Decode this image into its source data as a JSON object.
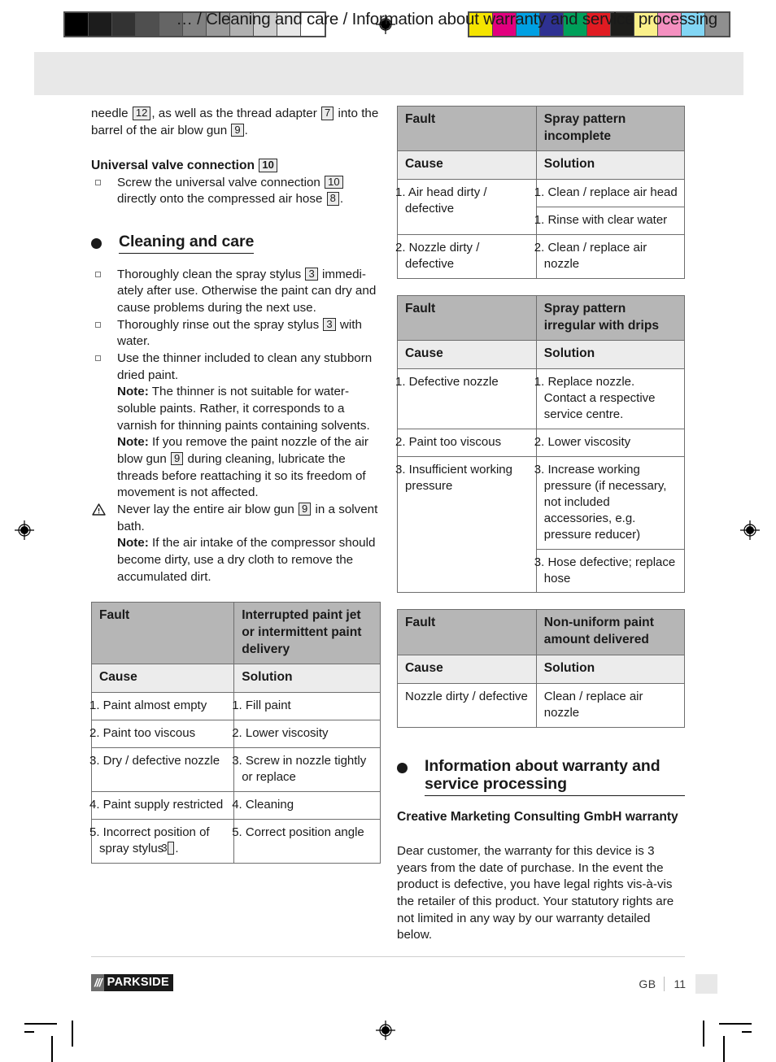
{
  "document": {
    "header_title": "… / Cleaning and care / Information about warranty and service processing",
    "footer": {
      "logo_slashes": "///",
      "logo_word": "PARKSIDE",
      "language": "GB",
      "page_number": "11"
    }
  },
  "calibration": {
    "gray_wedge": [
      "#000000",
      "#1c1c1c",
      "#333333",
      "#4f4f4f",
      "#656565",
      "#808080",
      "#999999",
      "#b0b0b0",
      "#cccccc",
      "#e8e8e8",
      "#ffffff"
    ],
    "color_patches": [
      "#f5e400",
      "#e2007f",
      "#00a0e3",
      "#2e3192",
      "#00a05a",
      "#e11b22",
      "#1d1d1b",
      "#faf08a",
      "#f490c0",
      "#82d6f5",
      "#8f8f8f"
    ]
  },
  "left_column": {
    "continued_paragraph": {
      "pre": "needle",
      "chip1": "12",
      "mid": ", as well as the thread adapter",
      "chip2": "7",
      "line2_pre": "into the barrel of the air blow gun",
      "chip3": "9",
      "line2_post": "."
    },
    "valve_subheading": {
      "text": "Universal valve connection",
      "chip": "10"
    },
    "valve_item": {
      "pre": "Screw the universal valve connection",
      "chip1": "10",
      "mid": "directly onto the compressed air hose",
      "chip2": "8",
      "post": "."
    },
    "cleaning_heading": "Cleaning and care",
    "cleaning_items": [
      {
        "marker": "square",
        "pre": "Thoroughly clean the spray stylus",
        "chip": "3",
        "post": "immedi-ately after use. Otherwise the paint can dry and cause problems during the next use."
      },
      {
        "marker": "square",
        "pre": "Thoroughly rinse out the spray stylus",
        "chip": "3",
        "post": "with water."
      },
      {
        "marker": "square",
        "pre": "Use the thinner included to clean any stubborn dried paint.",
        "note1_label": "Note:",
        "note1_text": "The thinner is not suitable for water-soluble paints. Rather, it corresponds to a varnish for thinning paints containing solvents.",
        "note2_label": "Note:",
        "note2_pre": "If you remove the paint nozzle of the air blow gun",
        "note2_chip": "9",
        "note2_post": "during cleaning, lubricate the threads before reattaching it so its freedom of movement is not affected."
      },
      {
        "marker": "warning",
        "pre": "Never lay the entire air blow gun",
        "chip": "9",
        "post": "in a solvent bath.",
        "note_label": "Note:",
        "note_text": "If the air intake of the compressor should become dirty, use a dry cloth to remove the accumulated dirt."
      }
    ],
    "table": {
      "fault_label": "Fault",
      "fault_value": "Interrupted paint jet or intermittent paint delivery",
      "cause_label": "Cause",
      "solution_label": "Solution",
      "rows": [
        {
          "cause": "1. Paint almost empty",
          "solution": "1. Fill paint"
        },
        {
          "cause": "2. Paint too viscous",
          "solution": "2. Lower viscosity"
        },
        {
          "cause": "3. Dry / defective nozzle",
          "solution": "3. Screw in nozzle tightly or replace"
        },
        {
          "cause": "4. Paint supply restricted",
          "solution": "4. Cleaning"
        },
        {
          "cause_pre": "5. Incorrect position of spray stylus",
          "cause_chip": "3",
          "cause_post": ".",
          "solution": "5. Correct position angle"
        }
      ]
    }
  },
  "right_column": {
    "table1": {
      "fault_label": "Fault",
      "fault_value": "Spray pattern incomplete",
      "cause_label": "Cause",
      "solution_label": "Solution",
      "rows": [
        {
          "cause": "1. Air head dirty / defective",
          "solution": "1. Clean / replace air head"
        },
        {
          "cause": "",
          "solution": "1. Rinse with clear water"
        },
        {
          "cause": "2. Nozzle dirty / defective",
          "solution": "2. Clean / replace air nozzle"
        }
      ]
    },
    "table2": {
      "fault_label": "Fault",
      "fault_value": "Spray pattern irregular with drips",
      "cause_label": "Cause",
      "solution_label": "Solution",
      "rows": [
        {
          "cause": "1. Defective nozzle",
          "solution": "1. Replace nozzle. Contact a respective service centre."
        },
        {
          "cause": "2. Paint too viscous",
          "solution": "2. Lower viscosity"
        },
        {
          "cause": "3. Insufficient working pressure",
          "solution": "3. Increase working pressure (if necessary, not included accessories, e.g. pressure reducer)"
        },
        {
          "cause": "",
          "solution": "3. Hose defective; replace hose"
        }
      ]
    },
    "table3": {
      "fault_label": "Fault",
      "fault_value": "Non-uniform paint amount delivered",
      "cause_label": "Cause",
      "solution_label": "Solution",
      "rows": [
        {
          "cause": "Nozzle dirty / defective",
          "solution": "Clean / replace air nozzle"
        }
      ]
    },
    "warranty_heading": "Information about warranty and service processing",
    "warranty_subheading": "Creative Marketing Consulting GmbH warranty",
    "warranty_body": "Dear customer, the warranty for this device is 3 years from the date of purchase. In the event the product is defective, you have legal rights vis-à-vis the retailer of this product. Your statutory rights are not limited in any way by our warranty detailed below."
  }
}
